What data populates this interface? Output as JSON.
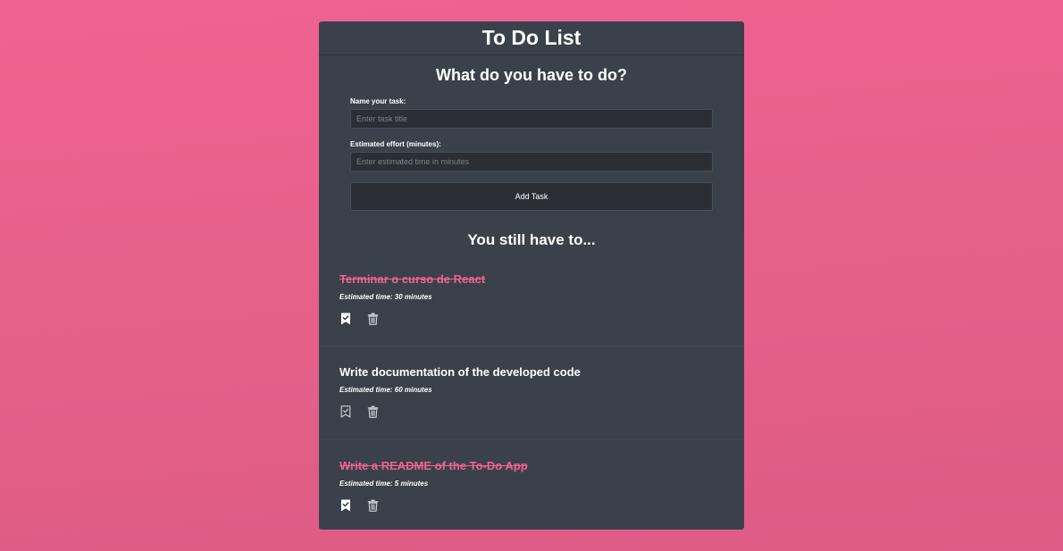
{
  "app": {
    "title": "To Do List"
  },
  "form": {
    "title": "What do you have to do?",
    "task_label": "Name your task:",
    "task_placeholder": "Enter task title",
    "effort_label": "Estimated effort (minutes):",
    "effort_placeholder": "Enter estimated time in minutes",
    "add_button_label": "Add Task"
  },
  "list": {
    "title": "You still have to...",
    "tasks": [
      {
        "title": "Terminar o curso de React",
        "time": "Estimated time: 30 minutes",
        "completed": true,
        "complete_icon": "bookmark-check-filled-icon",
        "delete_icon": "trash-icon"
      },
      {
        "title": "Write documentation of the developed code",
        "time": "Estimated time: 60 minutes",
        "completed": false,
        "complete_icon": "bookmark-check-outline-icon",
        "delete_icon": "trash-icon"
      },
      {
        "title": "Write a README of the To-Do App",
        "time": "Estimated time: 5 minutes",
        "completed": true,
        "complete_icon": "bookmark-check-filled-icon",
        "delete_icon": "trash-icon"
      }
    ]
  },
  "colors": {
    "background": "#f06292",
    "card": "#3b414a",
    "accent": "#f06292",
    "input_bg": "#2b2f35",
    "text": "#ffffff"
  }
}
